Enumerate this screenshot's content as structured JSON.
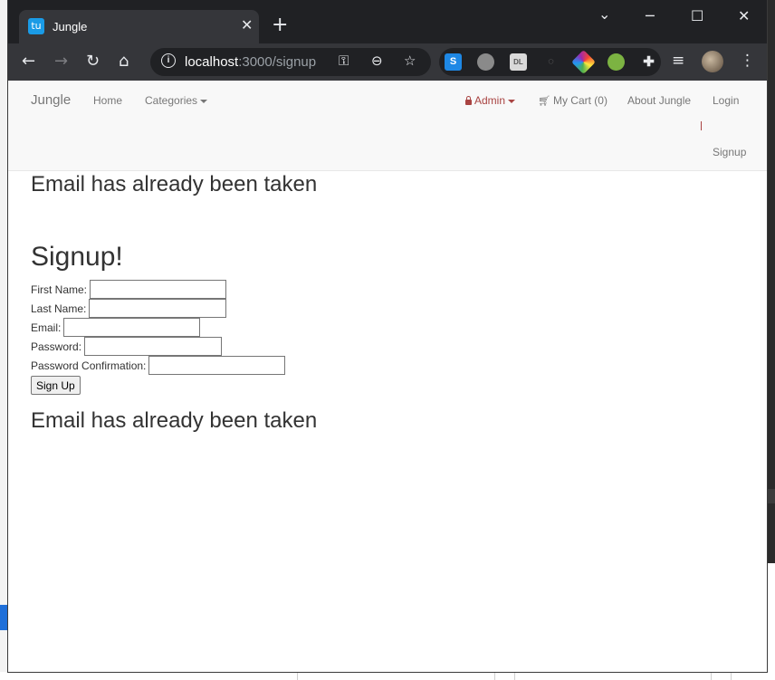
{
  "browser": {
    "tab_title": "Jungle",
    "tab_favicon_text": "tu",
    "url_host": "localhost",
    "url_path": ":3000/signup",
    "new_tab_symbol": "+",
    "close_symbol": "✕"
  },
  "navbar": {
    "brand": "Jungle",
    "home": "Home",
    "categories": "Categories",
    "admin": "Admin",
    "cart": "My Cart (0)",
    "about": "About Jungle",
    "login": "Login",
    "signup": "Signup"
  },
  "page": {
    "error_top": "Email has already been taken",
    "title": "Signup!",
    "error_bottom": "Email has already been taken"
  },
  "form": {
    "first_name_label": "First Name:",
    "last_name_label": "Last Name:",
    "email_label": "Email:",
    "password_label": "Password:",
    "password_confirmation_label": "Password Confirmation:",
    "submit_label": "Sign Up",
    "first_name_value": "",
    "last_name_value": "",
    "email_value": "",
    "password_value": "",
    "password_confirmation_value": ""
  },
  "colors": {
    "titlebar": "#202124",
    "toolbar": "#35363a",
    "navbar_bg": "#f8f8f8",
    "admin_accent": "#a94442",
    "text": "#333333"
  }
}
